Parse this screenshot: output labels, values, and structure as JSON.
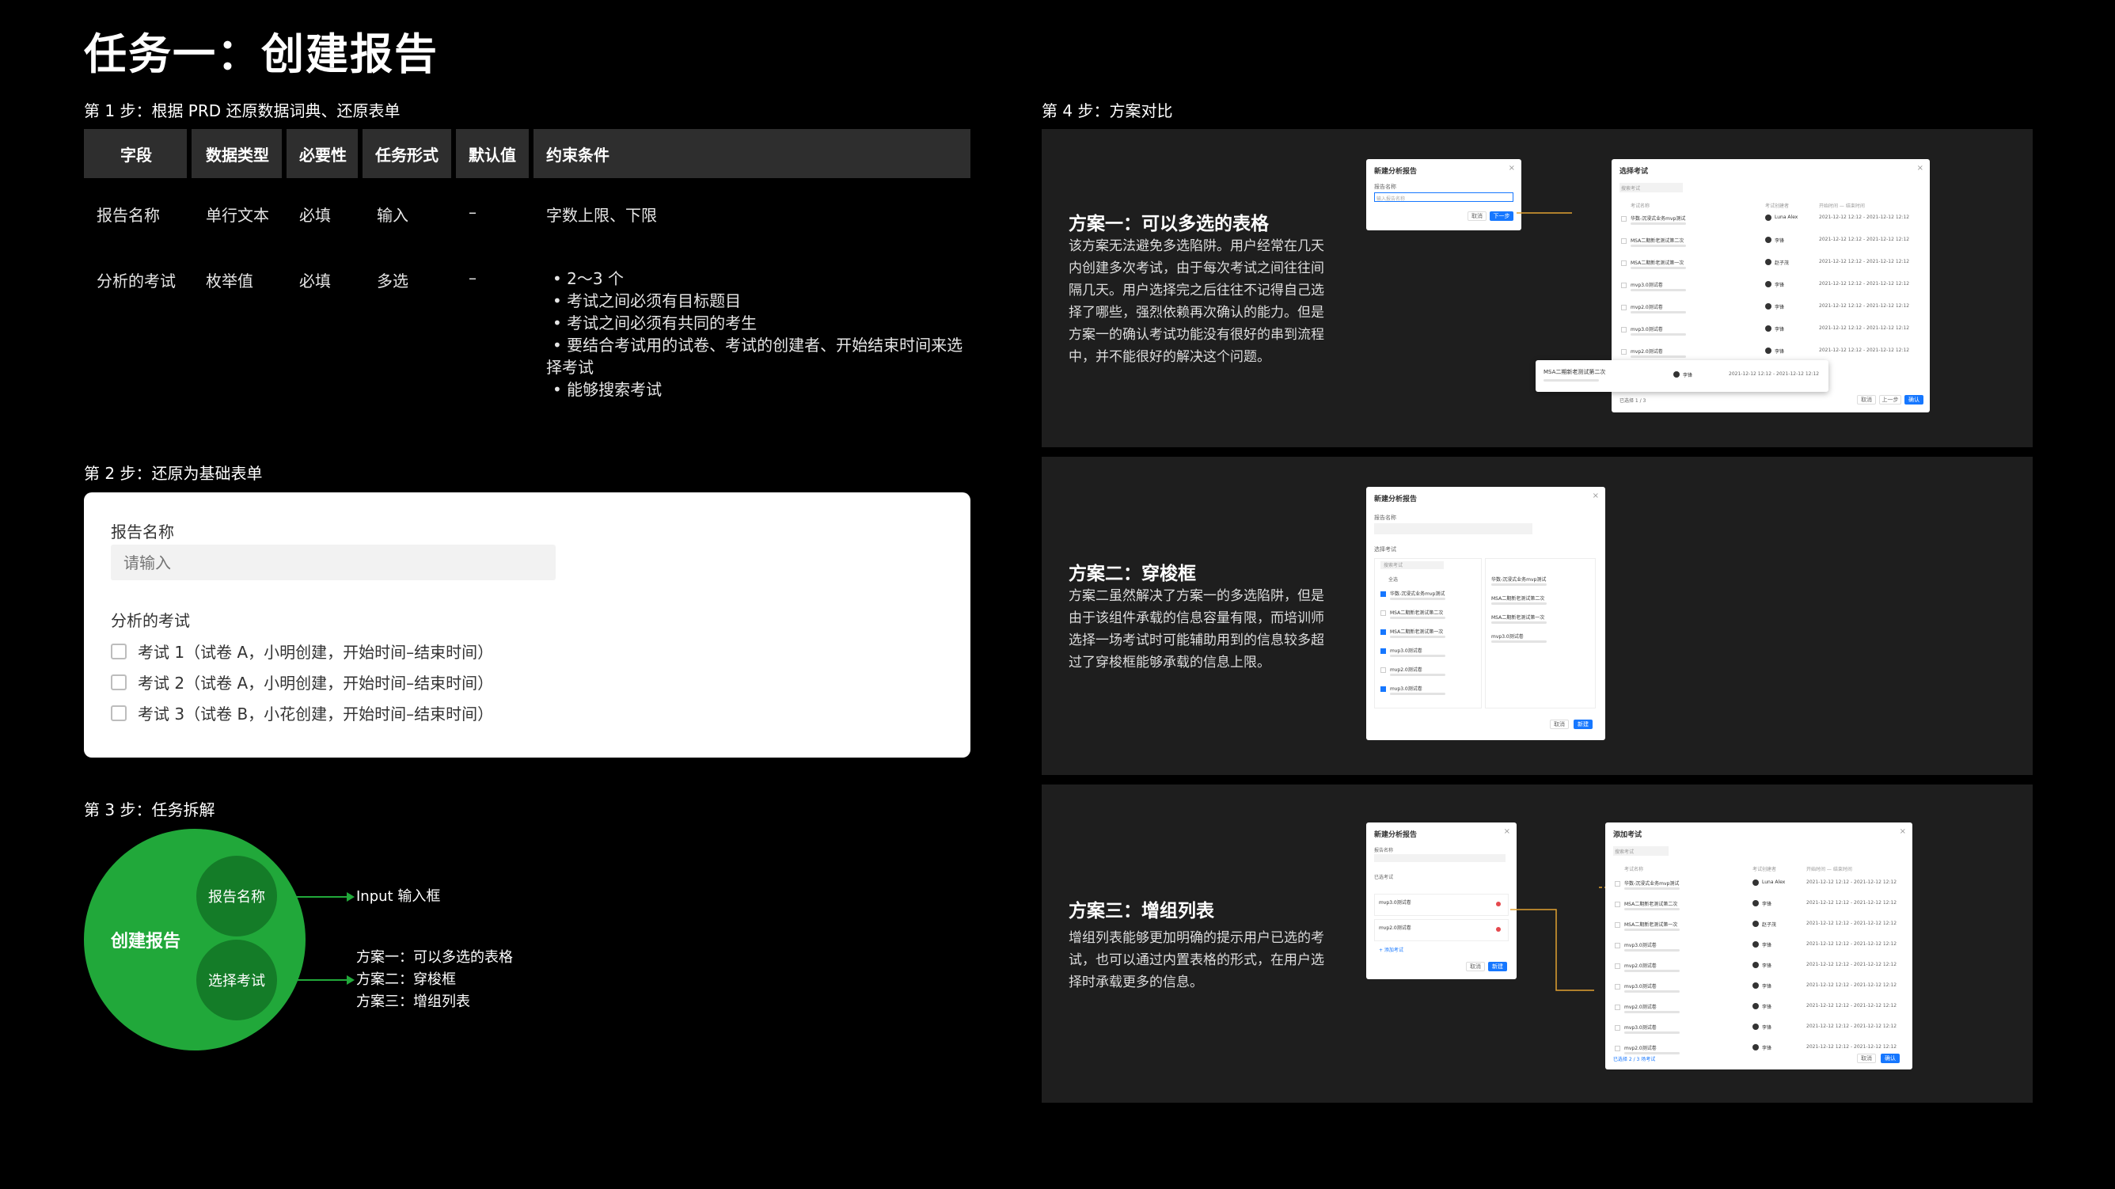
{
  "page_title": "任务一：创建报告",
  "step1": {
    "label": "第 1 步：根据 PRD 还原数据词典、还原表单",
    "headers": [
      "字段",
      "数据类型",
      "必要性",
      "任务形式",
      "默认值",
      "约束条件"
    ],
    "rows": [
      {
        "field": "报告名称",
        "type": "单行文本",
        "required": "必填",
        "form": "输入",
        "default": "–",
        "constraint": "字数上限、下限"
      },
      {
        "field": "分析的考试",
        "type": "枚举值",
        "required": "必填",
        "form": "多选",
        "default": "–",
        "constraints": [
          "•  2～3 个",
          "•  考试之间必须有目标题目",
          "•  考试之间必须有共同的考生",
          "•  要结合考试用的试卷、考试的创建者、开始结束时间来选",
          "择考试",
          "•  能够搜索考试"
        ]
      }
    ]
  },
  "step2": {
    "label": "第 2 步：还原为基础表单",
    "name_label": "报告名称",
    "name_placeholder": "请输入",
    "exam_label": "分析的考试",
    "options": [
      "考试 1（试卷 A，小明创建，开始时间–结束时间）",
      "考试 2（试卷 A，小明创建，开始时间–结束时间）",
      "考试 3（试卷 B，小花创建，开始时间–结束时间）"
    ]
  },
  "step3": {
    "label": "第 3 步：任务拆解",
    "root": "创建报告",
    "node1": "报告名称",
    "node2": "选择考试",
    "out1": "Input 输入框",
    "out2": [
      "方案一：可以多选的表格",
      "方案二：穿梭框",
      "方案三：增组列表"
    ]
  },
  "step4": {
    "label": "第 4 步：方案对比",
    "plans": [
      {
        "title": "方案一：可以多选的表格",
        "desc": "该方案无法避免多选陷阱。用户经常在几天内创建多次考试，由于每次考试之间往往间隔几天。用户选择完之后往往不记得自己选择了哪些，强烈依赖再次确认的能力。但是方案一的确认考试功能没有很好的串到流程中，并不能很好的解决这个问题。"
      },
      {
        "title": "方案二：穿梭框",
        "desc": "方案二虽然解决了方案一的多选陷阱，但是由于该组件承载的信息容量有限，而培训师选择一场考试时可能辅助用到的信息较多超过了穿梭框能够承载的信息上限。"
      },
      {
        "title": "方案三：增组列表",
        "desc": "增组列表能够更加明确的提示用户已选的考试，也可以通过内置表格的形式，在用户选择时承载更多的信息。"
      }
    ]
  },
  "mock": {
    "new_report": "新建分析报告",
    "report_name": "报告名称",
    "placeholder": "输入报告名称",
    "next": "下一步",
    "cancel": "取消",
    "create": "新建",
    "select_exam": "选择考试",
    "add_exam": "添加考试",
    "search": "搜索考试",
    "col_name": "考试名称",
    "col_creator": "考试创建者",
    "col_time": "开始时间 — 结束时间",
    "time_val": "2021-12-12 12:12 - 2021-12-12 12:12",
    "exams": [
      "华数-沉浸式业务mvp测试",
      "MSA二期新老测试第二次",
      "MSA二期新老测试第一次",
      "mvp3.0测试卷",
      "mvp2.0测试卷",
      "mvp3.0测试卷",
      "mvp2.0测试卷",
      "mvp3.0测试卷",
      "mvp2.0测试卷"
    ],
    "creators": [
      "Luna Alex",
      "李锋",
      "赵子茂",
      "李锋",
      "李锋",
      "李锋",
      "李锋"
    ],
    "popup_exam": "MSA二期新老测试第二次",
    "popup_creator": "李锋",
    "selected_count": "已选择 1 / 3",
    "prev": "上一步",
    "confirm": "确认",
    "all": "全选",
    "selected_label": "已选考试",
    "add_btn": "+ 添加考试",
    "tip": "已选择 2 / 3 场考试"
  }
}
